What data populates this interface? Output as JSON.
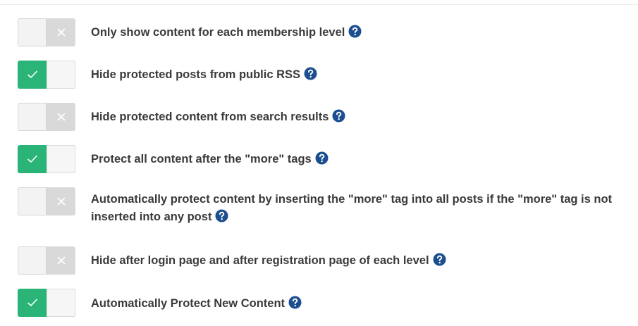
{
  "colors": {
    "toggle_on": "#2bb478",
    "toggle_off": "#d9d9d9",
    "label_text": "#3a3a3a",
    "help_icon": "#1c4f8f"
  },
  "icons": {
    "on_mark": "check-icon",
    "off_mark": "x-icon",
    "help": "question-circle-icon"
  },
  "settings": [
    {
      "label": "Only show content for each membership level",
      "enabled": false
    },
    {
      "label": "Hide protected posts from public RSS",
      "enabled": true
    },
    {
      "label": "Hide protected content from search results",
      "enabled": false
    },
    {
      "label": "Protect all content after the \"more\" tags",
      "enabled": true
    },
    {
      "label": "Automatically protect content by inserting the \"more\" tag into all posts if the \"more\" tag is not inserted into any post",
      "enabled": false
    },
    {
      "label": "Hide after login page and after registration page of each level",
      "enabled": false
    },
    {
      "label": "Automatically Protect New Content",
      "enabled": true
    }
  ]
}
